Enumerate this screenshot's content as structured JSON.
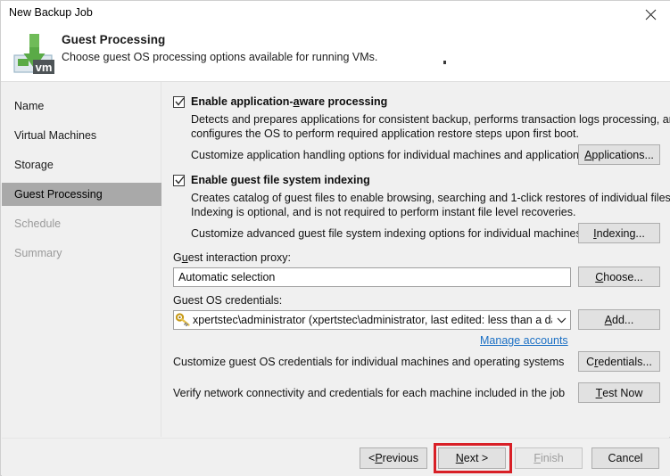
{
  "window": {
    "title": "New Backup Job",
    "close_icon": "close-icon"
  },
  "header": {
    "icon": "veeam-vm-download-icon",
    "title": "Guest Processing",
    "subtitle": "Choose guest OS processing options available for running VMs."
  },
  "sidebar": {
    "items": [
      {
        "label": "Name",
        "state": "normal"
      },
      {
        "label": "Virtual Machines",
        "state": "normal"
      },
      {
        "label": "Storage",
        "state": "normal"
      },
      {
        "label": "Guest Processing",
        "state": "selected"
      },
      {
        "label": "Schedule",
        "state": "disabled"
      },
      {
        "label": "Summary",
        "state": "disabled"
      }
    ]
  },
  "main": {
    "app_aware": {
      "checked": true,
      "label_pre": "Enable application-",
      "label_accel": "a",
      "label_post": "ware processing",
      "desc_line1": "Detects and prepares applications for consistent backup, performs transaction logs processing, and",
      "desc_line2": "configures the OS to perform required application restore steps upon first boot.",
      "customize_text": "Customize application handling options for individual machines and applications",
      "button_accel": "A",
      "button_rest": "pplications..."
    },
    "indexing": {
      "checked": true,
      "label": "Enable guest file system indexing",
      "desc_line1": "Creates catalog of guest files to enable browsing, searching and 1-click restores of individual files.",
      "desc_line2": "Indexing is optional, and is not required to perform instant file level recoveries.",
      "customize_text": "Customize advanced guest file system indexing options for individual machines",
      "button_accel": "I",
      "button_rest": "ndexing..."
    },
    "proxy": {
      "label_pre": "G",
      "label_accel": "u",
      "label_post": "est interaction proxy:",
      "value": "Automatic selection",
      "button_accel": "C",
      "button_rest": "hoose..."
    },
    "credentials": {
      "label": "Guest OS credentials:",
      "icon": "key-icon",
      "value": "xpertstec\\administrator (xpertstec\\administrator, last edited: less than a day a",
      "dropdown_icon": "chevron-down-icon",
      "button_accel": "A",
      "button_rest": "dd...",
      "manage_link": "Manage accounts"
    },
    "customize_credentials": {
      "text": "Customize guest OS credentials for individual machines and operating systems",
      "button_pre": "C",
      "button_accel": "r",
      "button_rest": "edentials..."
    },
    "test": {
      "text": "Verify network connectivity and credentials for each machine included in the job",
      "button_accel": "T",
      "button_rest": "est Now"
    }
  },
  "footer": {
    "previous_pre": "< ",
    "previous_accel": "P",
    "previous_rest": "revious",
    "next_accel": "N",
    "next_rest": "ext >",
    "finish_accel": "F",
    "finish_rest": "inish",
    "finish_disabled": true,
    "cancel": "Cancel",
    "highlight_color": "#d81f26",
    "highlighted_button": "next-button"
  },
  "colors": {
    "selected_nav_bg": "#a9a9a9",
    "link": "#1a6fc4",
    "annotation_red": "#d81f26",
    "icon_green": "#5aaa46",
    "key_yellow": "#e8c24a"
  }
}
